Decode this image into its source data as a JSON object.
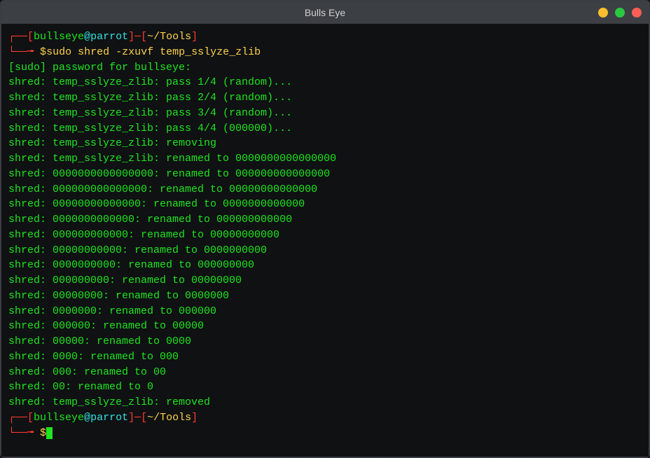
{
  "window": {
    "title": "Bulls Eye"
  },
  "prompt1": {
    "corner_top": "┌──",
    "lb": "[",
    "user": "bullseye",
    "at": "@",
    "host": "parrot",
    "rb": "]",
    "dash": "─",
    "lb2": "[",
    "path": "~/Tools",
    "rb2": "]",
    "corner_bot": "└──╼ ",
    "dollar": "$",
    "command": "sudo shred -zxuvf temp_sslyze_zlib"
  },
  "output": [
    "[sudo] password for bullseye:",
    "shred: temp_sslyze_zlib: pass 1/4 (random)...",
    "shred: temp_sslyze_zlib: pass 2/4 (random)...",
    "shred: temp_sslyze_zlib: pass 3/4 (random)...",
    "shred: temp_sslyze_zlib: pass 4/4 (000000)...",
    "shred: temp_sslyze_zlib: removing",
    "shred: temp_sslyze_zlib: renamed to 0000000000000000",
    "shred: 0000000000000000: renamed to 000000000000000",
    "shred: 000000000000000: renamed to 00000000000000",
    "shred: 00000000000000: renamed to 0000000000000",
    "shred: 0000000000000: renamed to 000000000000",
    "shred: 000000000000: renamed to 00000000000",
    "shred: 00000000000: renamed to 0000000000",
    "shred: 0000000000: renamed to 000000000",
    "shred: 000000000: renamed to 00000000",
    "shred: 00000000: renamed to 0000000",
    "shred: 0000000: renamed to 000000",
    "shred: 000000: renamed to 00000",
    "shred: 00000: renamed to 0000",
    "shred: 0000: renamed to 000",
    "shred: 000: renamed to 00",
    "shred: 00: renamed to 0",
    "shred: temp_sslyze_zlib: removed"
  ],
  "prompt2": {
    "corner_top": "┌──",
    "lb": "[",
    "user": "bullseye",
    "at": "@",
    "host": "parrot",
    "rb": "]",
    "dash": "─",
    "lb2": "[",
    "path": "~/Tools",
    "rb2": "]",
    "corner_bot": "└──╼ ",
    "dollar": "$"
  }
}
